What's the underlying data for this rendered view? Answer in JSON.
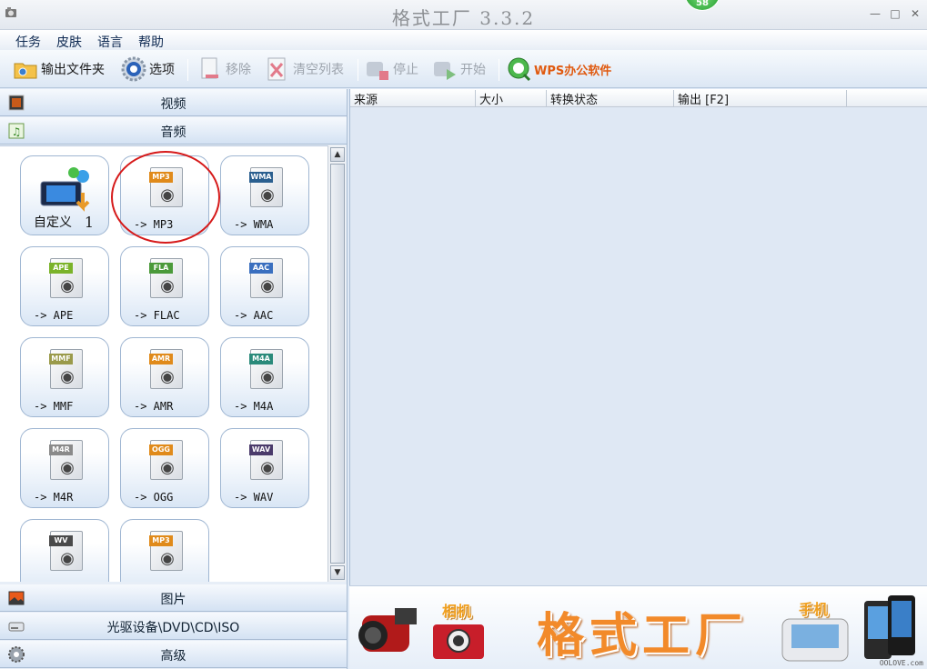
{
  "window": {
    "title": "格式工厂 3.3.2",
    "badge": "58"
  },
  "menu": [
    "任务",
    "皮肤",
    "语言",
    "帮助"
  ],
  "toolbar": {
    "output_folder": "输出文件夹",
    "options": "选项",
    "remove": "移除",
    "clear_list": "清空列表",
    "stop": "停止",
    "start": "开始",
    "wps": "WPS办公软件"
  },
  "categories": {
    "video": "视频",
    "audio": "音频",
    "picture": "图片",
    "rom": "光驱设备\\DVD\\CD\\ISO",
    "advanced": "高级"
  },
  "tiles": [
    {
      "label": "自定义",
      "num": "1",
      "tag": ""
    },
    {
      "label": "-> MP3",
      "tag": "MP3",
      "tagColor": "#e08a1a"
    },
    {
      "label": "-> WMA",
      "tag": "WMA",
      "tagColor": "#2a5f8f"
    },
    {
      "label": "-> APE",
      "tag": "APE",
      "tagColor": "#7bb32a"
    },
    {
      "label": "-> FLAC",
      "tag": "FLA",
      "tagColor": "#4b9a3a"
    },
    {
      "label": "-> AAC",
      "tag": "AAC",
      "tagColor": "#3a6fbf"
    },
    {
      "label": "-> MMF",
      "tag": "MMF",
      "tagColor": "#9a9a4a"
    },
    {
      "label": "-> AMR",
      "tag": "AMR",
      "tagColor": "#e08a1a"
    },
    {
      "label": "-> M4A",
      "tag": "M4A",
      "tagColor": "#2a8a7a"
    },
    {
      "label": "-> M4R",
      "tag": "M4R",
      "tagColor": "#8a8a8a"
    },
    {
      "label": "-> OGG",
      "tag": "OGG",
      "tagColor": "#e08a1a"
    },
    {
      "label": "-> WAV",
      "tag": "WAV",
      "tagColor": "#4a3a6a"
    },
    {
      "label": "",
      "tag": "WV",
      "tagColor": "#4a4a4a"
    },
    {
      "label": "",
      "tag": "MP3",
      "tagColor": "#e08a1a"
    }
  ],
  "columns": [
    "来源",
    "大小",
    "转换状态",
    "输出 [F2]"
  ],
  "banner": {
    "title": "格式工厂",
    "camera": "相机",
    "phone": "手机",
    "site": "OOLOVE.com"
  }
}
